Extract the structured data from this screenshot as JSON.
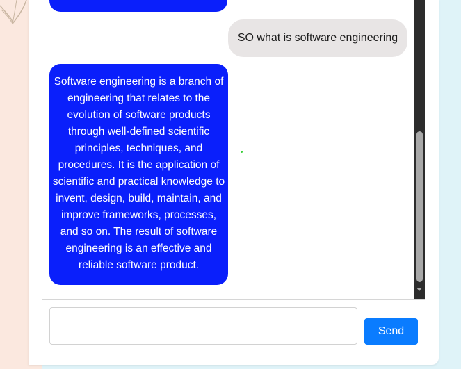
{
  "chat": {
    "messages": [
      {
        "sender": "bot",
        "text": ""
      },
      {
        "sender": "user",
        "text": "SO what is software engineering"
      },
      {
        "sender": "bot",
        "text": "Software engineering is a branch of engineering that relates to the evolution of software products through well-defined scientific principles, techniques, and procedures. It is the application of scientific and practical knowledge to invent, design, build, maintain, and improve frameworks, processes, and so on. The result of software engineering is an effective and reliable software product."
      }
    ]
  },
  "composer": {
    "input_value": "",
    "input_placeholder": "",
    "send_label": "Send"
  },
  "colors": {
    "bot_bubble": "#0a1ffb",
    "user_bubble": "#e8e5e5",
    "send_button": "#0a7cff",
    "scrollbar_track": "#2c2c2c",
    "scrollbar_thumb": "#a8a8a8",
    "page_left_bg": "#fbe8df",
    "page_right_bg": "#dff3f8"
  },
  "icons": {
    "corner_decoration": "leaf-outline-icon",
    "scroll_down": "triangle-down-icon"
  }
}
